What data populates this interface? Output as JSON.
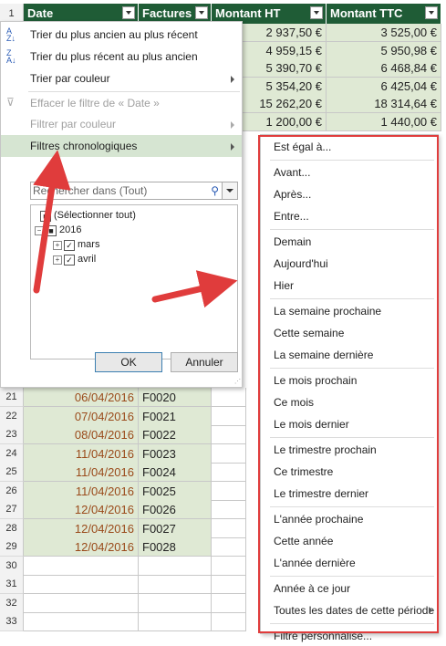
{
  "sheet": {
    "headers": {
      "row_num": "1",
      "date": "Date",
      "factures": "Factures",
      "ht": "Montant HT",
      "ttc": "Montant TTC"
    },
    "top_rows": [
      {
        "ht": "2 937,50 €",
        "ttc": "3 525,00 €"
      },
      {
        "ht": "4 959,15 €",
        "ttc": "5 950,98 €"
      },
      {
        "ht": "5 390,70 €",
        "ttc": "6 468,84 €"
      },
      {
        "ht": "5 354,20 €",
        "ttc": "6 425,04 €"
      },
      {
        "ht": "15 262,20 €",
        "ttc": "18 314,64 €"
      },
      {
        "ht": "1 200,00 €",
        "ttc": "1 440,00 €"
      }
    ],
    "rows": [
      {
        "num": "21",
        "date": "06/04/2016",
        "facture": "F0020"
      },
      {
        "num": "22",
        "date": "07/04/2016",
        "facture": "F0021"
      },
      {
        "num": "23",
        "date": "08/04/2016",
        "facture": "F0022"
      },
      {
        "num": "24",
        "date": "11/04/2016",
        "facture": "F0023"
      },
      {
        "num": "25",
        "date": "11/04/2016",
        "facture": "F0024"
      },
      {
        "num": "26",
        "date": "11/04/2016",
        "facture": "F0025"
      },
      {
        "num": "27",
        "date": "12/04/2016",
        "facture": "F0026"
      },
      {
        "num": "28",
        "date": "12/04/2016",
        "facture": "F0027"
      },
      {
        "num": "29",
        "date": "12/04/2016",
        "facture": "F0028"
      },
      {
        "num": "30",
        "date": "",
        "facture": ""
      },
      {
        "num": "31",
        "date": "",
        "facture": ""
      },
      {
        "num": "32",
        "date": "",
        "facture": ""
      },
      {
        "num": "33",
        "date": "",
        "facture": ""
      }
    ]
  },
  "menu": {
    "sort_old_new": "Trier du plus ancien au plus récent",
    "sort_new_old": "Trier du plus récent au plus ancien",
    "sort_color": "Trier par couleur",
    "clear_filter": "Effacer le filtre de « Date »",
    "filter_color": "Filtrer par couleur",
    "date_filters": "Filtres chronologiques",
    "search_placeholder": "Rechercher dans (Tout)",
    "tree": {
      "select_all": "(Sélectionner tout)",
      "year": "2016",
      "month1": "mars",
      "month2": "avril"
    },
    "ok": "OK",
    "cancel": "Annuler"
  },
  "submenu": [
    "Est égal à...",
    "Avant...",
    "Après...",
    "Entre...",
    "Demain",
    "Aujourd'hui",
    "Hier",
    "La semaine prochaine",
    "Cette semaine",
    "La semaine dernière",
    "Le mois prochain",
    "Ce mois",
    "Le mois dernier",
    "Le trimestre prochain",
    "Ce trimestre",
    "Le trimestre dernier",
    "L'année prochaine",
    "Cette année",
    "L'année dernière",
    "Année à ce jour",
    "Toutes les dates de cette période",
    "Filtre personnalisé..."
  ],
  "colors": {
    "header_green": "#1f5c36",
    "highlight": "#d6e5d2",
    "annotation_red": "#e03c3c",
    "date_text": "#9a4a1a"
  }
}
